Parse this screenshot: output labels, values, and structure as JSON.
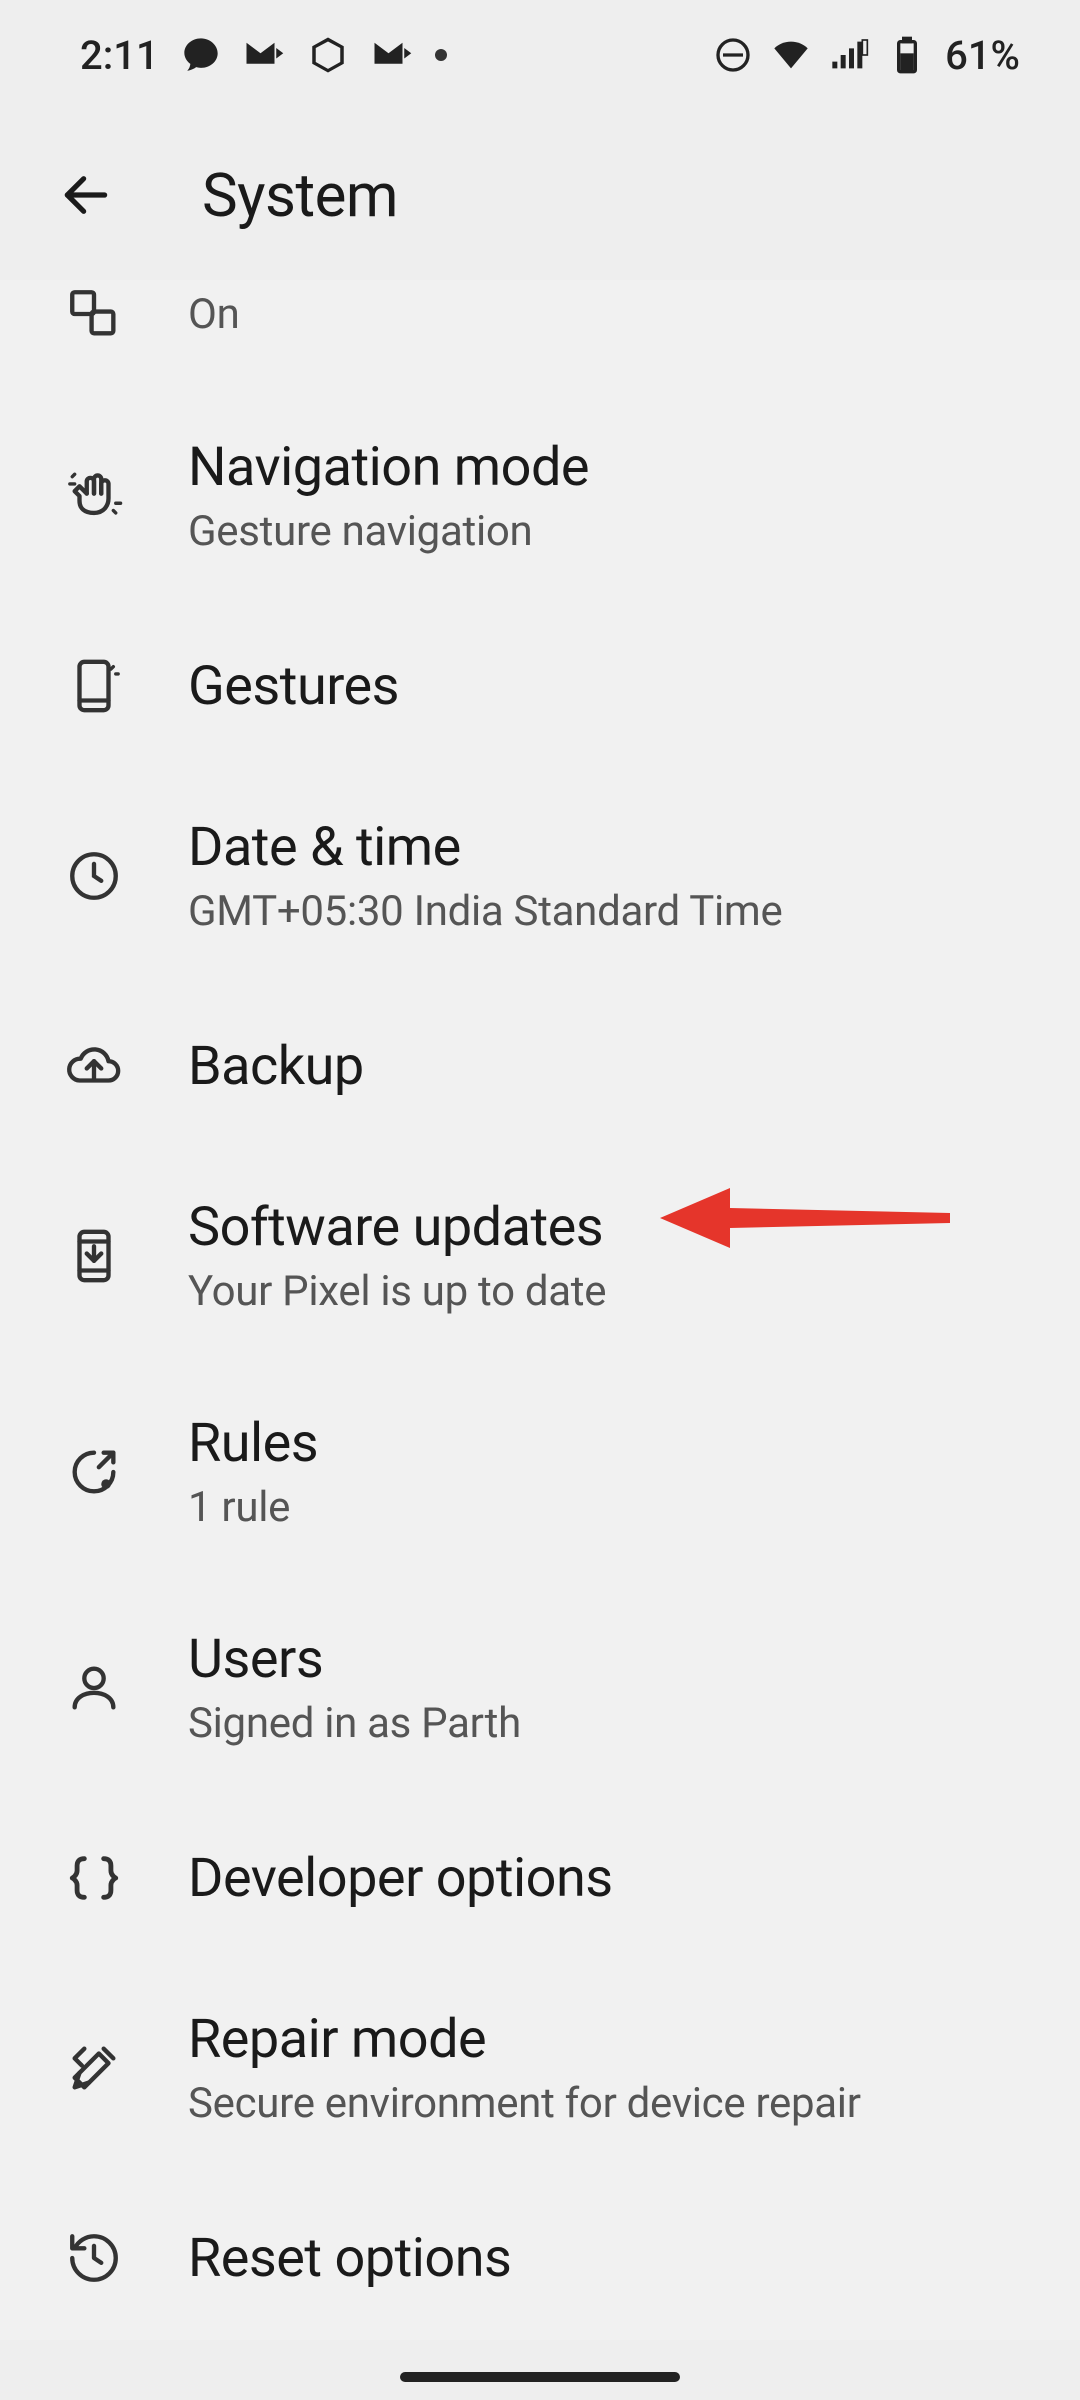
{
  "status": {
    "time": "2:11",
    "battery": "61%"
  },
  "header": {
    "title": "System"
  },
  "items": {
    "partial": {
      "sub": "On"
    },
    "nav": {
      "title": "Navigation mode",
      "sub": "Gesture navigation"
    },
    "gestures": {
      "title": "Gestures"
    },
    "datetime": {
      "title": "Date & time",
      "sub": "GMT+05:30 India Standard Time"
    },
    "backup": {
      "title": "Backup"
    },
    "updates": {
      "title": "Software updates",
      "sub": "Your Pixel is up to date"
    },
    "rules": {
      "title": "Rules",
      "sub": "1 rule"
    },
    "users": {
      "title": "Users",
      "sub": "Signed in as Parth"
    },
    "devops": {
      "title": "Developer options"
    },
    "repair": {
      "title": "Repair mode",
      "sub": "Secure environment for device repair"
    },
    "reset": {
      "title": "Reset options"
    }
  }
}
